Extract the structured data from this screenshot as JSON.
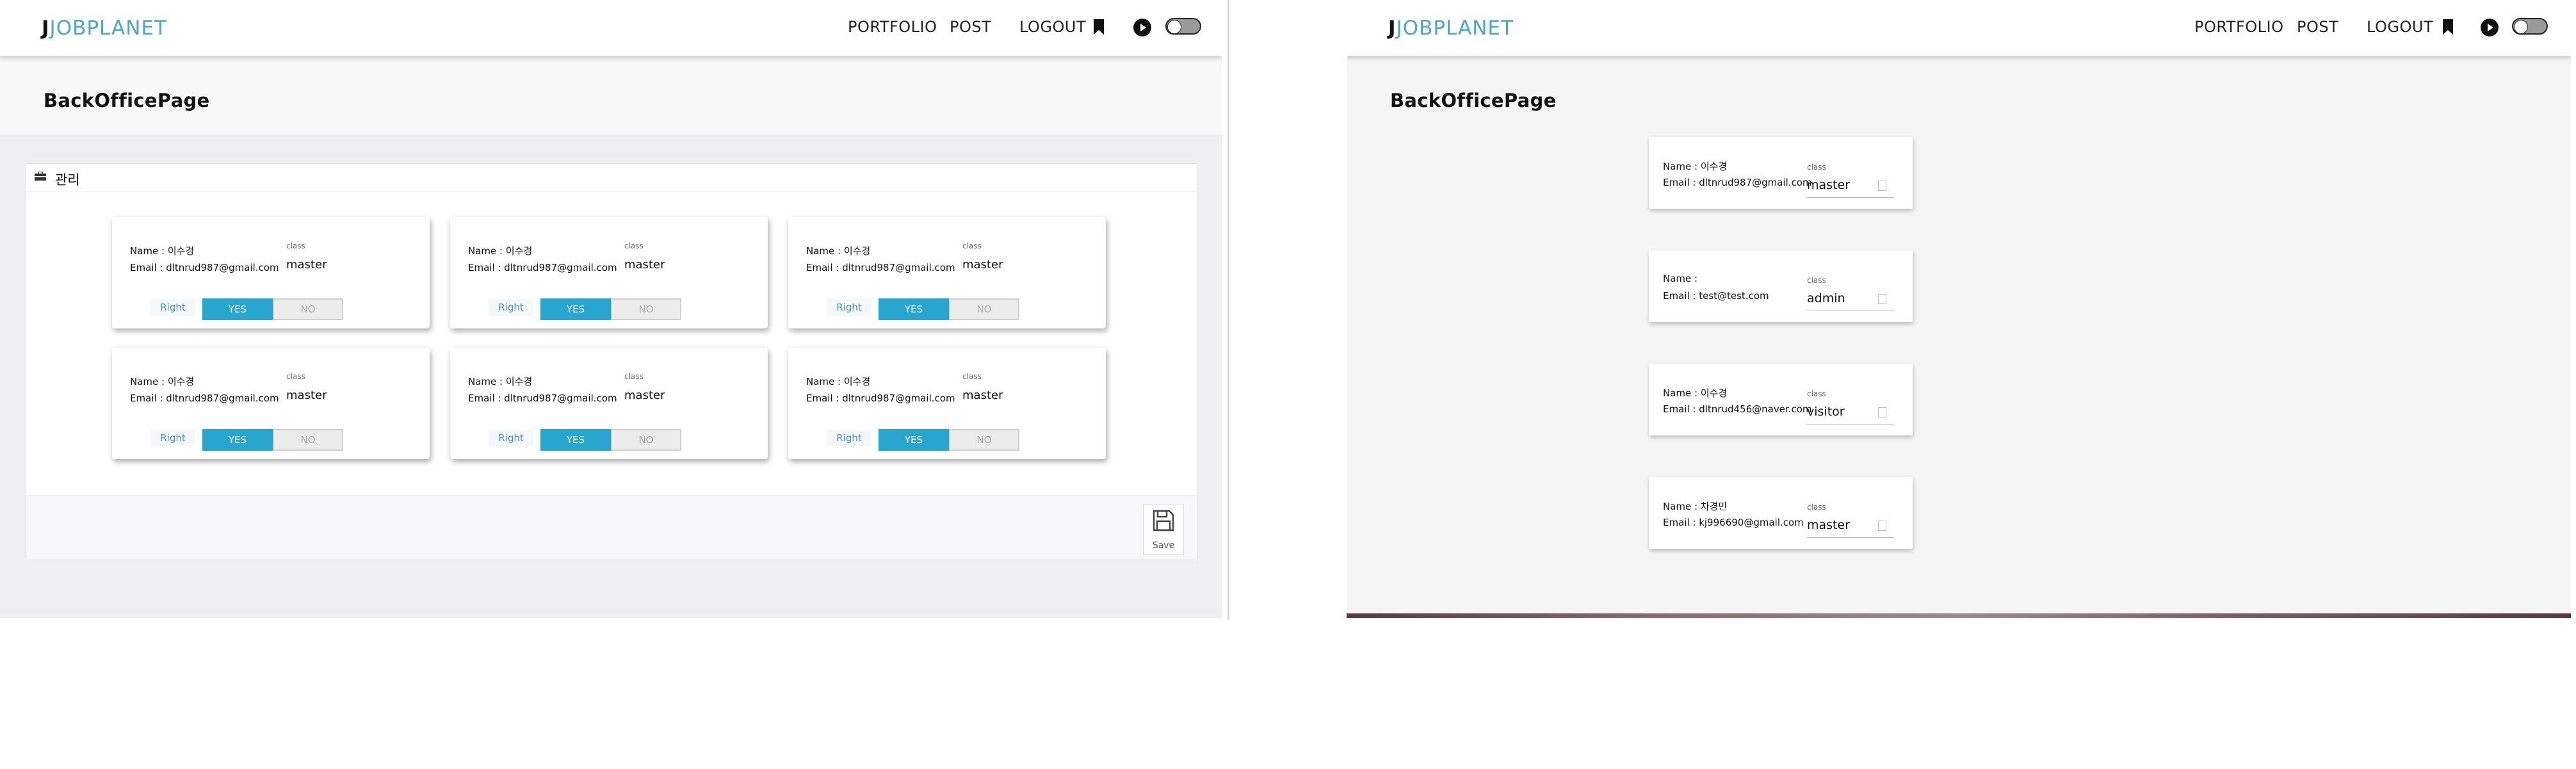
{
  "app": {
    "logo_j": "J",
    "logo_rest": "JOBPLANET",
    "nav": [
      "PORTFOLIO",
      "POST",
      "LOGOUT"
    ],
    "page_title": "BackOfficePage"
  },
  "left": {
    "panel_title": "관리",
    "save_label": "Save",
    "class_label": "class",
    "right_label": "Right",
    "yes_label": "YES",
    "no_label": "NO",
    "cards": [
      {
        "name": "Name : 이수경",
        "email": "Email : dltnrud987@gmail.com",
        "class": "master",
        "right": "yes"
      },
      {
        "name": "Name : 이수경",
        "email": "Email : dltnrud987@gmail.com",
        "class": "master",
        "right": "yes"
      },
      {
        "name": "Name : 이수경",
        "email": "Email : dltnrud987@gmail.com",
        "class": "master",
        "right": "yes"
      },
      {
        "name": "Name : 이수경",
        "email": "Email : dltnrud987@gmail.com",
        "class": "master",
        "right": "yes"
      },
      {
        "name": "Name : 이수경",
        "email": "Email : dltnrud987@gmail.com",
        "class": "master",
        "right": "yes"
      },
      {
        "name": "Name : 이수경",
        "email": "Email : dltnrud987@gmail.com",
        "class": "master",
        "right": "yes"
      }
    ]
  },
  "right": {
    "class_label": "class",
    "users": [
      {
        "name": "Name : 이수경",
        "email": "Email : dltnrud987@gmail.com",
        "class": "master"
      },
      {
        "name": "Name :",
        "email": "Email : test@test.com",
        "class": "admin"
      },
      {
        "name": "Name : 이수경",
        "email": "Email : dltnrud456@naver.com",
        "class": "visitor"
      },
      {
        "name": "Name : 차경민",
        "email": "Email : kj996690@gmail.com",
        "class": "master"
      }
    ]
  }
}
